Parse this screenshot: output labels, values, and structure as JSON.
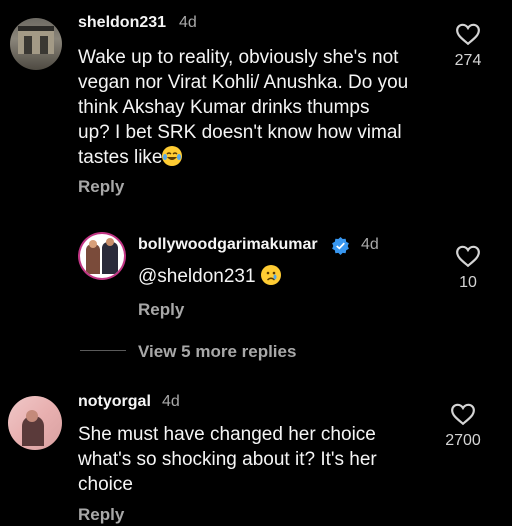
{
  "comments": [
    {
      "username": "sheldon231",
      "time": "4d",
      "text": "Wake up to reality, obviously she's not vegan nor Virat Kohli/ Anushka. Do you think Akshay Kumar drinks thumps up? I bet SRK doesn't know how vimal tastes like",
      "text_lines": [
        "Wake up to reality, obviously she's not",
        "vegan nor Virat Kohli/ Anushka. Do you",
        "think Akshay Kumar drinks thumps",
        "up? I bet SRK doesn't know how vimal",
        "tastes like"
      ],
      "reply_label": "Reply",
      "likes": "274"
    },
    {
      "username": "bollywoodgarimakumar",
      "time": "4d",
      "text": "@sheldon231",
      "reply_label": "Reply",
      "likes": "10",
      "verified": true
    },
    {
      "username": "notyorgal",
      "time": "4d",
      "text": "She must have changed her choice what's so shocking about it? It's her choice",
      "text_lines": [
        "She must have changed her choice",
        "what's so shocking about it? It's her",
        "choice"
      ],
      "reply_label": "Reply",
      "likes": "2700"
    }
  ],
  "view_more_replies": "View 5 more replies",
  "colors": {
    "background": "#000000",
    "text": "#f5f5f5",
    "secondary": "#a8a8a8",
    "verified": "#3897f0"
  },
  "icons": {
    "like": "heart-outline-icon",
    "verified": "verified-badge-icon",
    "laugh": "tears-of-joy-emoji",
    "sad": "crying-face-emoji"
  }
}
